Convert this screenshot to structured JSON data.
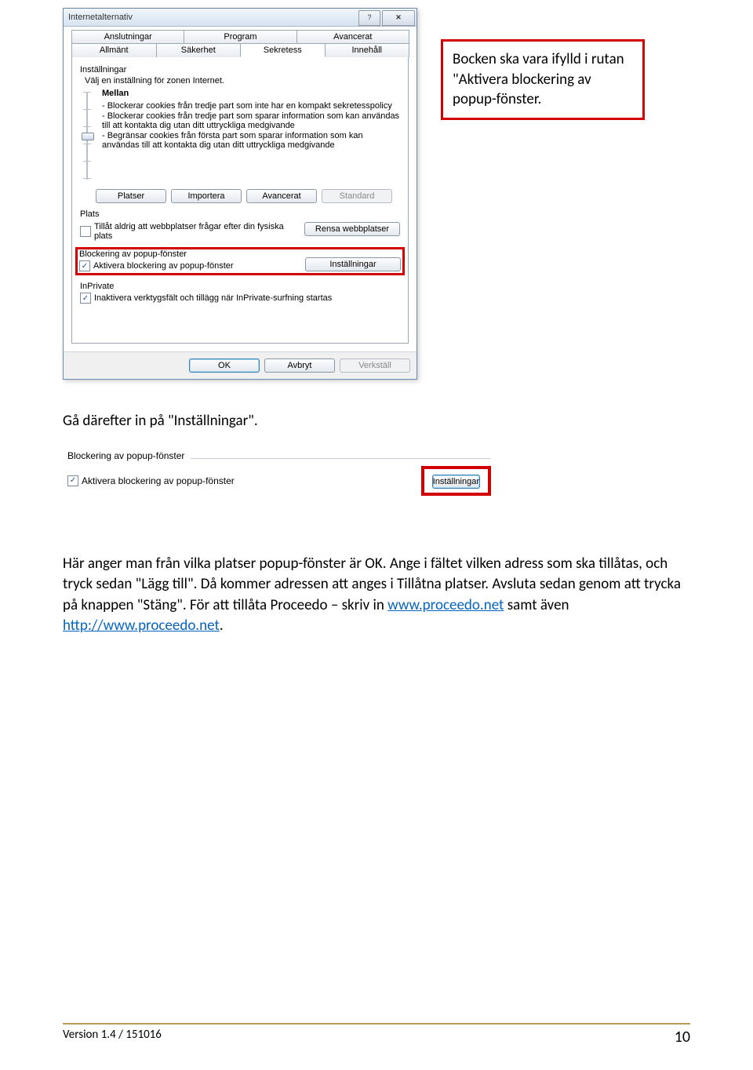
{
  "dialog": {
    "title": "Internetalternativ",
    "tabs_row1": [
      "Anslutningar",
      "Program",
      "Avancerat"
    ],
    "tabs_row2": [
      "Allmänt",
      "Säkerhet",
      "Sekretess",
      "Innehåll"
    ],
    "active_tab": "Sekretess",
    "settings_heading": "Inställningar",
    "zone_text": "Välj en inställning för zonen Internet.",
    "level_label": "Mellan",
    "desc": [
      "- Blockerar cookies från tredje part som inte har en kompakt sekretesspolicy",
      "- Blockerar cookies från tredje part som sparar information som kan användas till att kontakta dig utan ditt uttryckliga medgivande",
      "- Begränsar cookies från första part som sparar information som kan användas till att kontakta dig utan ditt uttryckliga medgivande"
    ],
    "buttons_row": [
      "Platser",
      "Importera",
      "Avancerat",
      "Standard"
    ],
    "plats_heading": "Plats",
    "plats_check": "Tillåt aldrig att webbplatser frågar efter din fysiska plats",
    "rensa_btn": "Rensa webbplatser",
    "popup_heading": "Blockering av popup-fönster",
    "popup_check": "Aktivera blockering av popup-fönster",
    "installningar_btn": "Inställningar",
    "inprivate_heading": "InPrivate",
    "inprivate_check": "Inaktivera verktygsfält och tillägg när InPrivate-surfning startas",
    "ok": "OK",
    "cancel": "Avbryt",
    "apply": "Verkställ"
  },
  "callout": "Bocken ska vara ifylld i rutan \"Aktivera blockering av popup-fönster.",
  "para1": "Gå därefter in på \"Inställningar\".",
  "snippet2": {
    "title": "Blockering av popup-fönster",
    "check": "Aktivera blockering av popup-fönster",
    "btn": "Inställningar"
  },
  "para2_a": "Här anger man från vilka platser popup-fönster är OK. Ange i fältet vilken adress som ska tillåtas, och tryck sedan \"Lägg till\". Då kommer adressen att anges i Tillåtna platser. Avsluta sedan genom att trycka på knappen \"Stäng\". För att tillåta Proceedo – skriv in ",
  "para2_link1": "www.proceedo.net",
  "para2_b": " samt även ",
  "para2_link2": "http://www.proceedo.net",
  "para2_c": ".",
  "footer_version": "Version 1.4 / 151016",
  "page_number": "10"
}
